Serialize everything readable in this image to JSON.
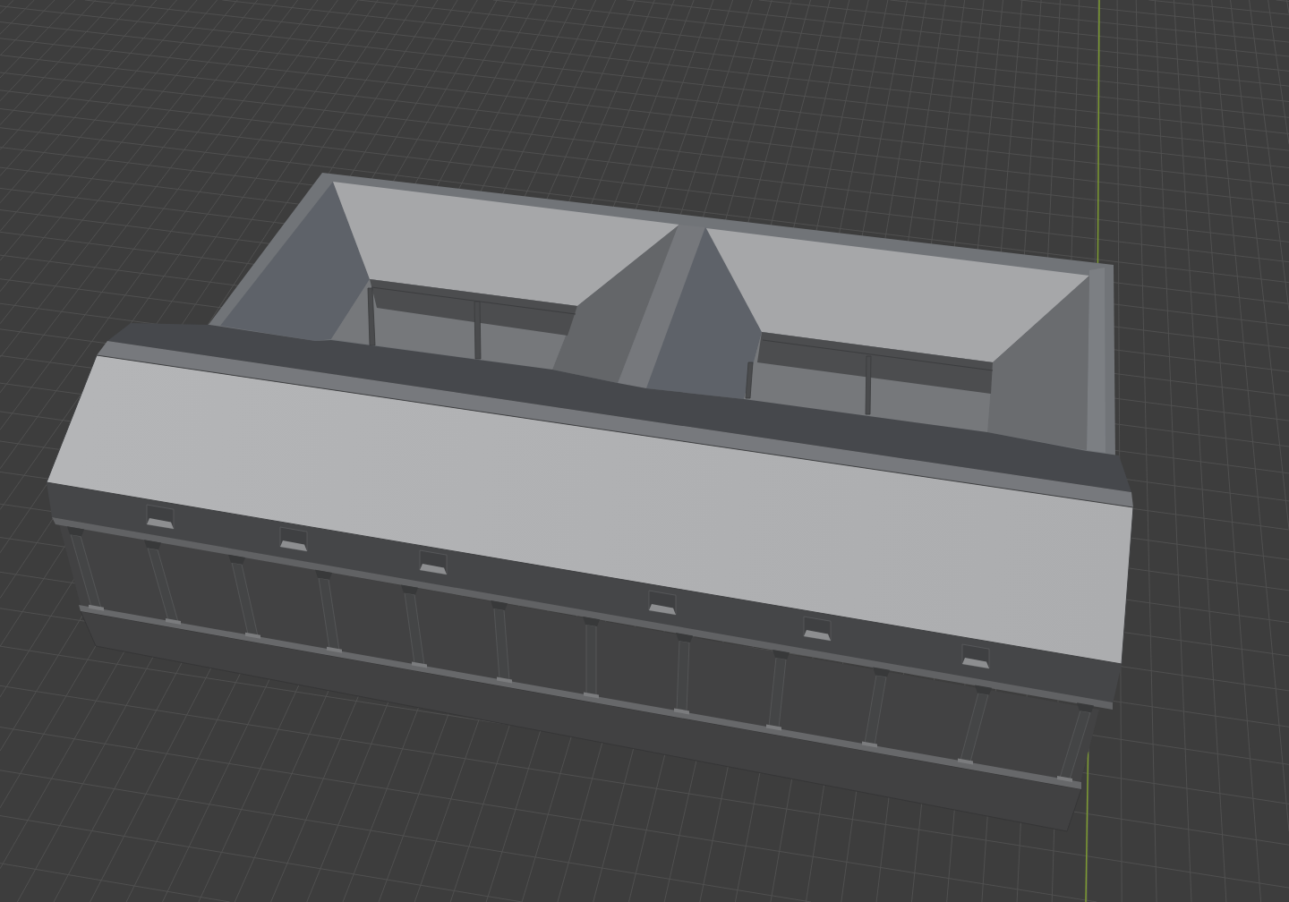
{
  "viewport": {
    "grid_visible": true,
    "y_axis_visible": true,
    "model": {
      "kind": "building"
    }
  }
}
